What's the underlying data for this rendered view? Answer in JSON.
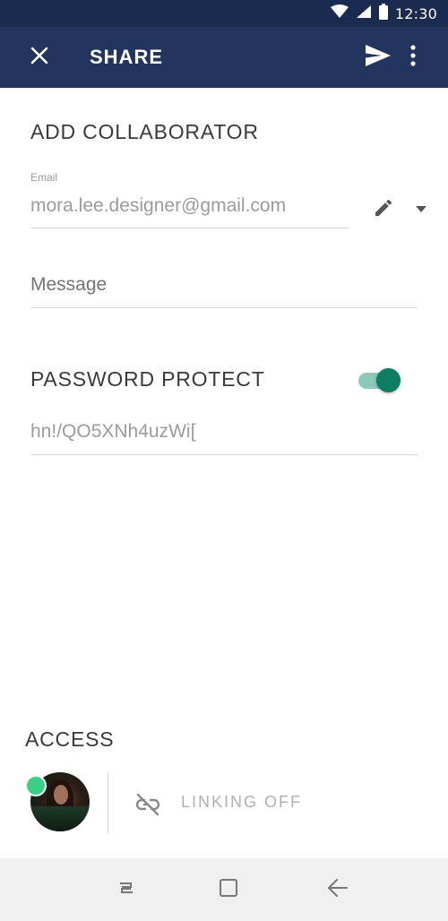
{
  "status_bar": {
    "time": "12:30",
    "icons": [
      "wifi-icon",
      "signal-icon",
      "battery-icon"
    ]
  },
  "app_bar": {
    "title": "SHARE",
    "close_icon": "close-icon",
    "send_icon": "send-icon",
    "more_icon": "more-vert-icon"
  },
  "collaborator": {
    "section_title": "ADD COLLABORATOR",
    "email_label": "Email",
    "email_value": "mora.lee.designer@gmail.com",
    "message_placeholder": "Message",
    "message_value": ""
  },
  "password": {
    "section_title": "PASSWORD PROTECT",
    "enabled": true,
    "value": "hn!/QO5XNh4uzWi["
  },
  "access": {
    "section_title": "ACCESS",
    "online": true,
    "linking_label": "LINKING OFF"
  },
  "nav_bar": {
    "icons": [
      "recents-icon",
      "home-icon",
      "back-icon"
    ]
  },
  "colors": {
    "status_bar": "#1b2a4f",
    "app_bar": "#23345e",
    "toggle_thumb": "#0e7e63",
    "toggle_track": "#8cc9b8",
    "online": "#3ccf86"
  }
}
